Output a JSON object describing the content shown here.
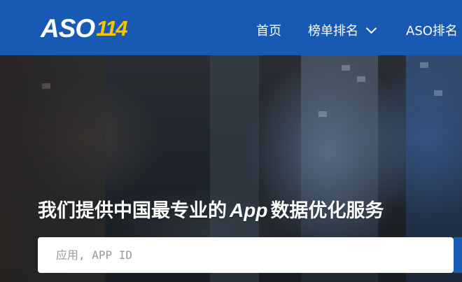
{
  "header": {
    "logo_text": "ASO",
    "logo_number": "114",
    "nav": {
      "home": "首页",
      "rankings": "榜单排名",
      "aso_rankings": "ASO排名"
    }
  },
  "hero": {
    "headline_before": "我们提供中国最专业的",
    "headline_app": "App",
    "headline_after": "数据优化服务",
    "search_placeholder": "应用, APP ID"
  },
  "colors": {
    "header_bg": "#1759b3",
    "logo_accent": "#f5c400"
  }
}
